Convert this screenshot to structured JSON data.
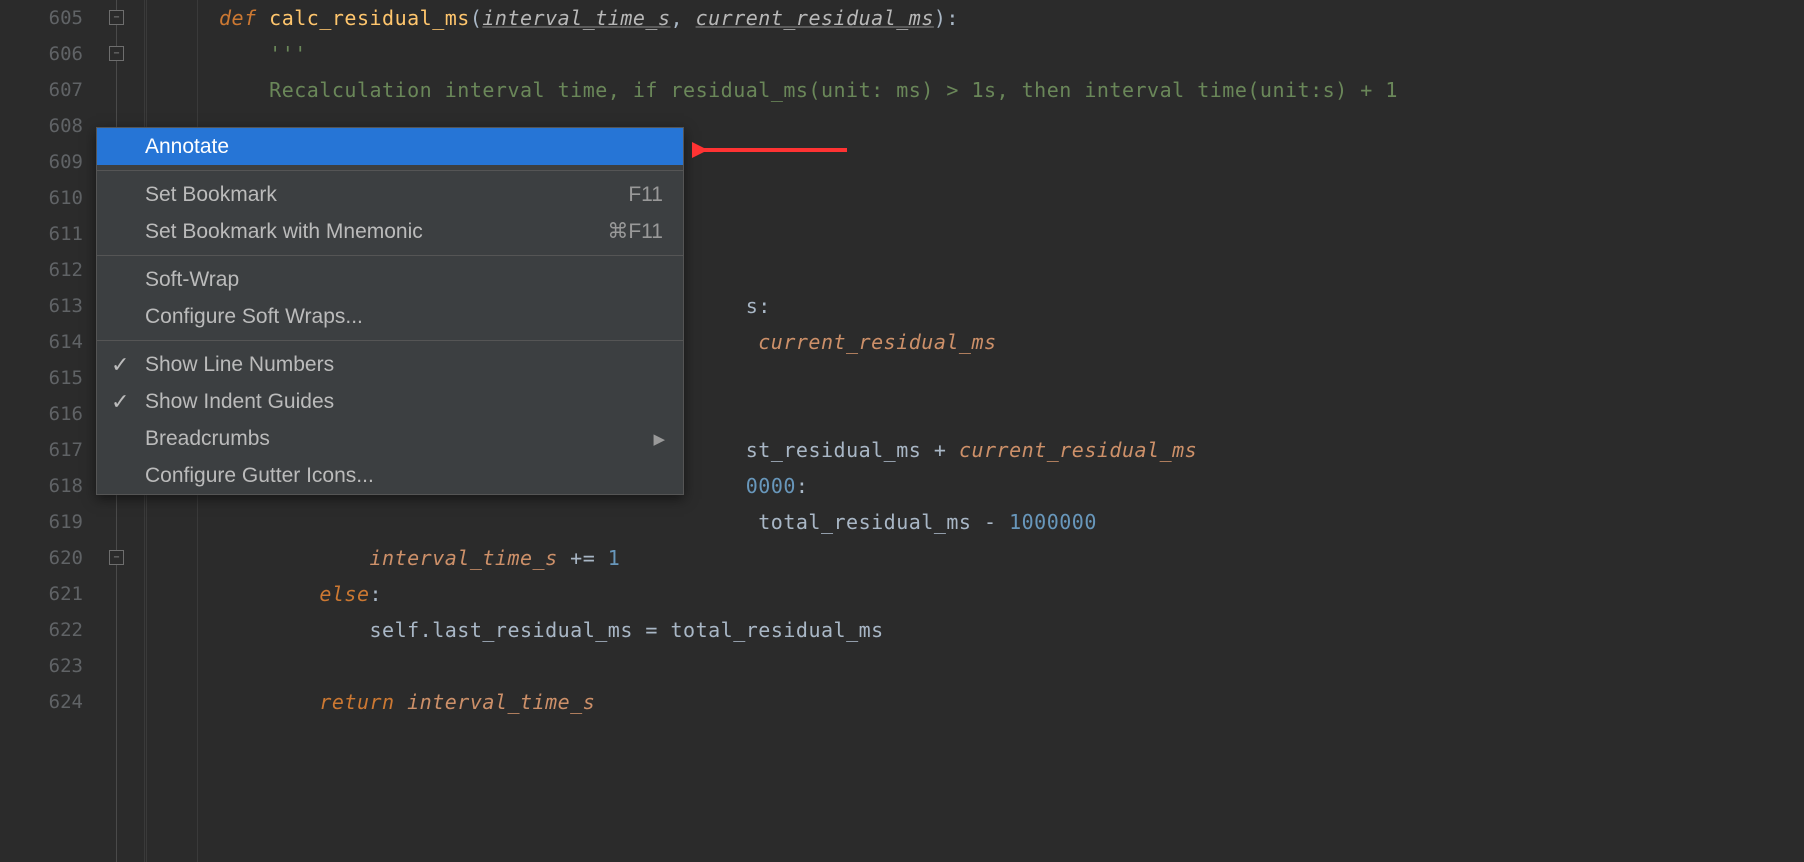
{
  "lines": [
    {
      "num": "605"
    },
    {
      "num": "606"
    },
    {
      "num": "607"
    },
    {
      "num": "608"
    },
    {
      "num": "609"
    },
    {
      "num": "610"
    },
    {
      "num": "611"
    },
    {
      "num": "612"
    },
    {
      "num": "613"
    },
    {
      "num": "614"
    },
    {
      "num": "615"
    },
    {
      "num": "616"
    },
    {
      "num": "617"
    },
    {
      "num": "618"
    },
    {
      "num": "619"
    },
    {
      "num": "620"
    },
    {
      "num": "621"
    },
    {
      "num": "622"
    },
    {
      "num": "623"
    },
    {
      "num": "624"
    }
  ],
  "code": {
    "l605": {
      "def": "def",
      "fn": "calc_residual_ms",
      "p1": "interval_time_s",
      "p2": "current_residual_ms",
      "paren_open": "(",
      "comma": ", ",
      "paren_close": "):"
    },
    "l606": {
      "text": "'''"
    },
    "l607": {
      "text": "Recalculation interval time, if residual_ms(unit: ms) > 1s, then interval time(unit:s) + 1"
    },
    "l613": {
      "colon": "s:",
      "text_before": ""
    },
    "l614": {
      "var": "current_residual_ms"
    },
    "l617": {
      "text": "st_residual_ms",
      "op": " + ",
      "var": "current_residual_ms"
    },
    "l618": {
      "text": "0000",
      "colon": ":"
    },
    "l619": {
      "text": "total_residual_ms",
      "op": " - ",
      "num": "1000000"
    },
    "l620": {
      "var": "interval_time_s",
      "op": " += ",
      "num": "1"
    },
    "l621": {
      "kw": "else",
      "colon": ":"
    },
    "l622": {
      "self": "self",
      "dot": ".",
      "attr": "last_residual_ms",
      "eq": " = ",
      "rhs": "total_residual_ms"
    },
    "l624": {
      "kw": "return",
      "var": "interval_time_s"
    }
  },
  "menu": {
    "annotate": "Annotate",
    "set_bookmark": "Set Bookmark",
    "set_bookmark_shortcut": "F11",
    "set_bookmark_mnemonic": "Set Bookmark with Mnemonic",
    "set_bookmark_mnemonic_shortcut": "⌘F11",
    "soft_wrap": "Soft-Wrap",
    "configure_soft_wraps": "Configure Soft Wraps...",
    "show_line_numbers": "Show Line Numbers",
    "show_indent_guides": "Show Indent Guides",
    "breadcrumbs": "Breadcrumbs",
    "configure_gutter_icons": "Configure Gutter Icons..."
  }
}
